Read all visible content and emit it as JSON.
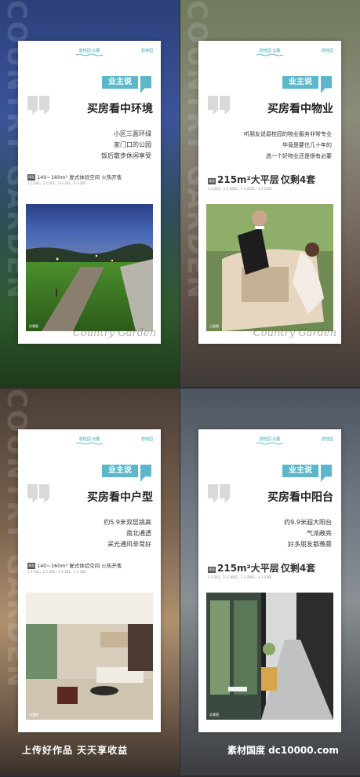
{
  "brand": {
    "logo_text": "碧桂园·云麓",
    "right_mark": "碧桂园"
  },
  "watermark": "COUNTRY GARDEN",
  "signature": "Country Garden",
  "posters": [
    {
      "tag": "业主说",
      "headline": "买房看中环境",
      "lines": [
        "小区三面环绿",
        "家门口的公园",
        "饭后散步休闲享受"
      ],
      "spec_badge": "建面",
      "spec_area": "140~160m²",
      "spec_desc": "复式体验空间  火热开售",
      "spec_sub": "2-1-301，2-1-501，5-1-301，5-1-302",
      "photo": "park-path-photo",
      "photo_caption": "实景图"
    },
    {
      "tag": "业主说",
      "headline": "买房看中物业",
      "lines": [
        "听朋友说碧桂园的物业服务非常专业",
        "毕竟是要住几十年的",
        "选一个好物业还是很有必要"
      ],
      "spec_badge": "建面",
      "spec_area": "215m²大平层",
      "spec_desc": "仅剩4套",
      "spec_sub": "1-1-201，1-1-1602，1-1-2001，1-1-2301",
      "photo": "doorman-car-photo",
      "photo_caption": "示意图"
    },
    {
      "tag": "业主说",
      "headline": "买房看中户型",
      "lines": [
        "约5.9米双层挑高",
        "南北通透",
        "采光通风非常好"
      ],
      "spec_badge": "建面",
      "spec_area": "140~160m²",
      "spec_desc": "复式体验空间  火热开售",
      "spec_sub": "2-1-301，2-1-501，5-1-301，5-1-302",
      "photo": "living-room-photo",
      "photo_caption": "实景图"
    },
    {
      "tag": "业主说",
      "headline": "买房看中阳台",
      "lines": [
        "约9.9米超大阳台",
        "气派敞亮",
        "好多朋友都羡慕"
      ],
      "spec_badge": "建面",
      "spec_area": "215m²大平层",
      "spec_desc": "仅剩4套",
      "spec_sub": "1-1-201，1-1-1602，1-1-2001，1-1-2301",
      "photo": "balcony-photo",
      "photo_caption": "实景图"
    }
  ],
  "footer": {
    "left": "上传好作品  天天享收益",
    "right": "素材国度  dc10000.com"
  },
  "colors": {
    "accent": "#5cb8c9",
    "brand": "#3aa7b5",
    "headline": "#222222"
  }
}
